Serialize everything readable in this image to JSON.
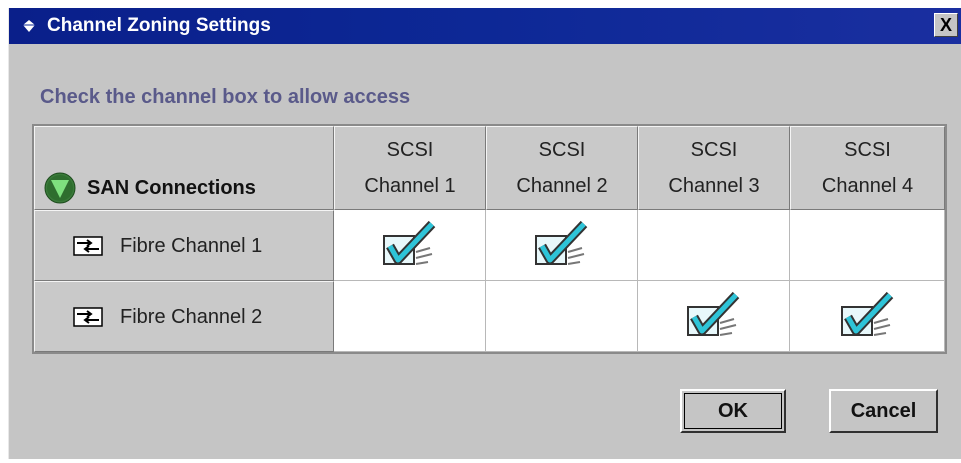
{
  "window": {
    "title": "Channel Zoning Settings",
    "close_label": "X"
  },
  "instruction": "Check the channel box to allow access",
  "table": {
    "corner_label": "SAN Connections",
    "columns": [
      {
        "line1": "SCSI",
        "line2": "Channel 1"
      },
      {
        "line1": "SCSI",
        "line2": "Channel 2"
      },
      {
        "line1": "SCSI",
        "line2": "Channel 3"
      },
      {
        "line1": "SCSI",
        "line2": "Channel 4"
      }
    ],
    "rows": [
      {
        "label": "Fibre Channel 1",
        "checked": [
          true,
          true,
          false,
          false
        ]
      },
      {
        "label": "Fibre Channel 2",
        "checked": [
          false,
          false,
          true,
          true
        ]
      }
    ]
  },
  "buttons": {
    "ok": "OK",
    "cancel": "Cancel"
  },
  "colors": {
    "titlebar": "#0d2896",
    "dialog_bg": "#c5c5c5",
    "instruction": "#5a5a8a",
    "check": "#2ec4d8"
  }
}
